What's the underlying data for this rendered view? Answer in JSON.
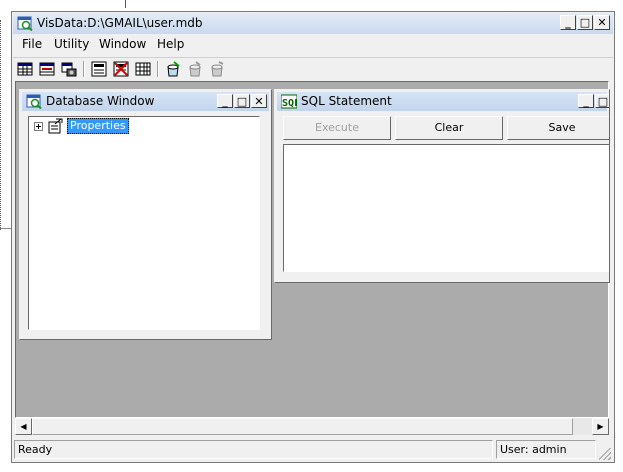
{
  "window": {
    "title": "VisData:D:\\GMAIL\\user.mdb"
  },
  "title_buttons": {
    "minimize": "_",
    "maximize": "□",
    "close": "✕"
  },
  "menu": [
    "File",
    "Utility",
    "Window",
    "Help"
  ],
  "toolbar_icons": [
    "table-type-icon",
    "dynaset-type-icon",
    "snapshot-type-icon",
    "data-control-icon",
    "no-data-control-icon",
    "grid-icon",
    "begin-transaction-icon",
    "commit-icon",
    "rollback-icon"
  ],
  "database_window": {
    "title": "Database Window",
    "tree": [
      {
        "label": "Properties",
        "expander": "+"
      }
    ]
  },
  "sql_window": {
    "title": "SQL Statement",
    "buttons": {
      "execute": "Execute",
      "clear": "Clear",
      "save": "Save"
    },
    "text": ""
  },
  "status": {
    "left": "Ready",
    "right": "User: admin"
  },
  "colors": {
    "titlebar": "#c9d9ee",
    "mdi_bg": "#ababab",
    "selection": "#3399ff"
  }
}
